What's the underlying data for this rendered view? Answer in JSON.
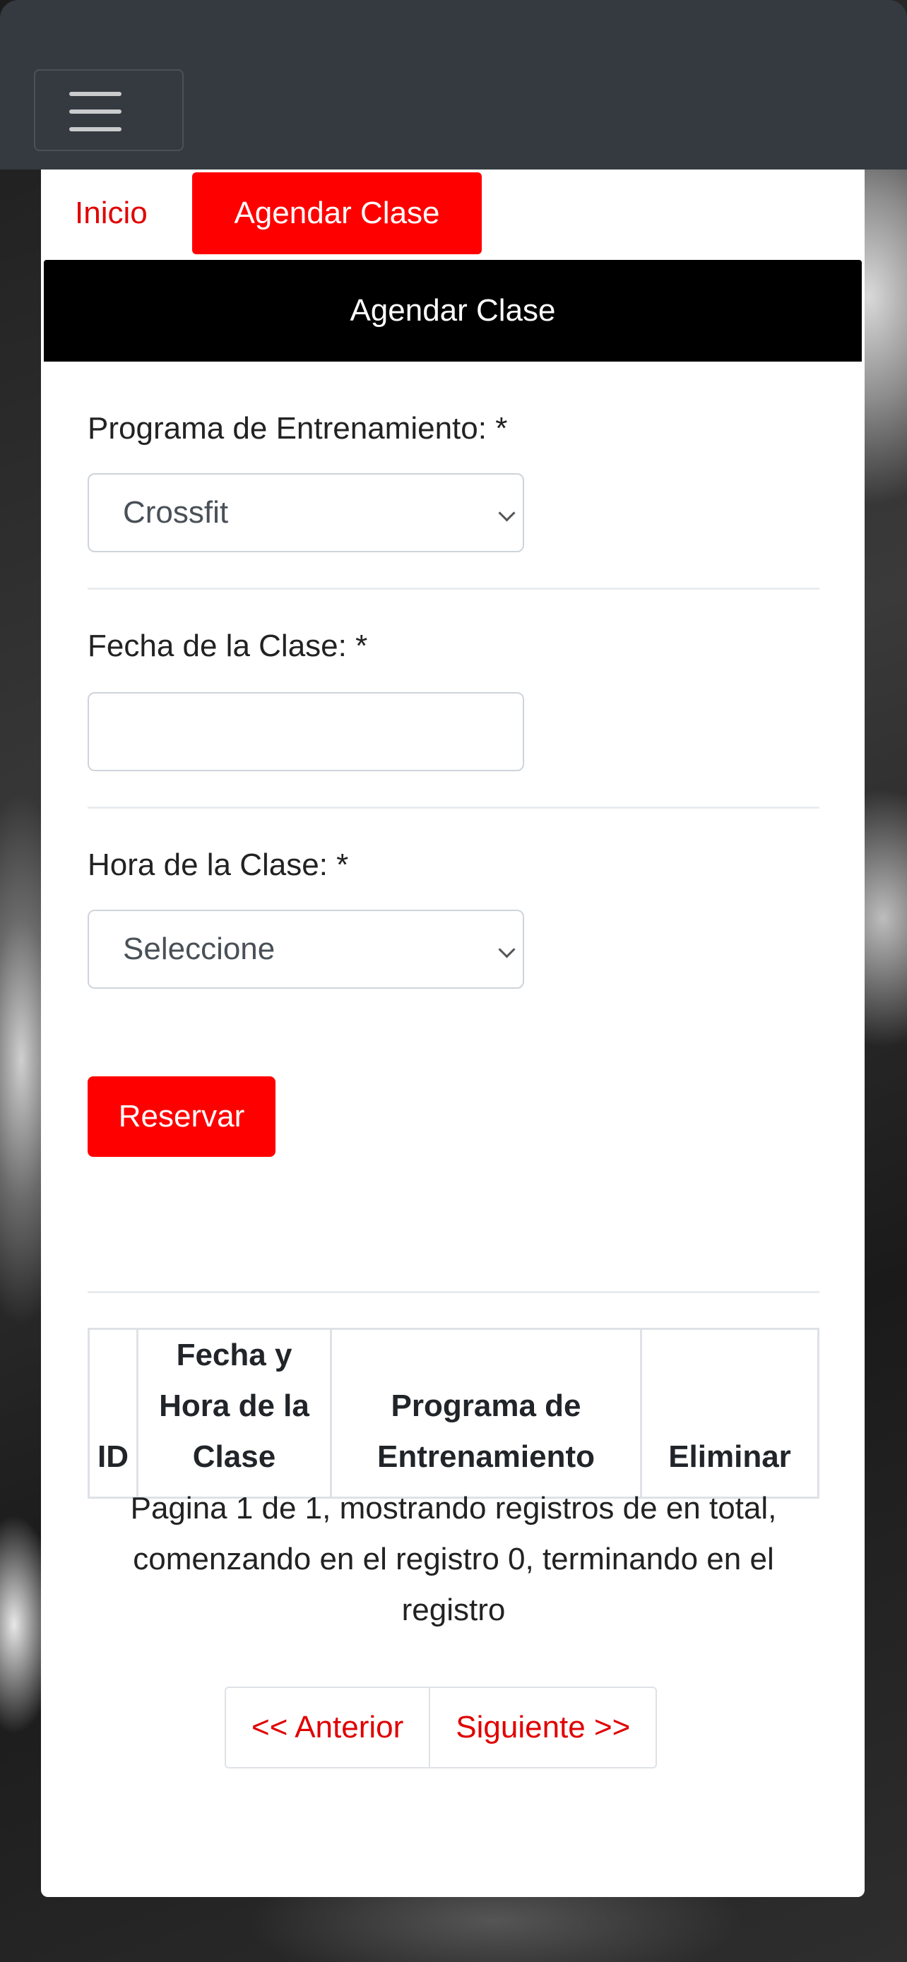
{
  "navbar": {
    "toggle_icon": "hamburger-menu-icon"
  },
  "tabs": {
    "home": "Inicio",
    "schedule": "Agendar Clase"
  },
  "card": {
    "header": "Agendar Clase"
  },
  "form": {
    "program_label": "Programa de Entrenamiento: *",
    "program_value": "Crossfit",
    "date_label": "Fecha de la Clase: *",
    "date_value": "",
    "time_label": "Hora de la Clase: *",
    "time_value": "Seleccione",
    "submit_label": "Reservar"
  },
  "table": {
    "headers": [
      "ID",
      "Fecha y Hora de la Clase",
      "Programa de Entrenamiento",
      "Eliminar"
    ]
  },
  "pagination": {
    "summary": "Pagina 1 de 1, mostrando registros de en total, comenzando en el registro 0, terminando en el registro",
    "prev": "<< Anterior",
    "next": "Siguiente >>"
  },
  "colors": {
    "accent": "#ff0000",
    "navbar": "#343a40",
    "header": "#000000"
  }
}
